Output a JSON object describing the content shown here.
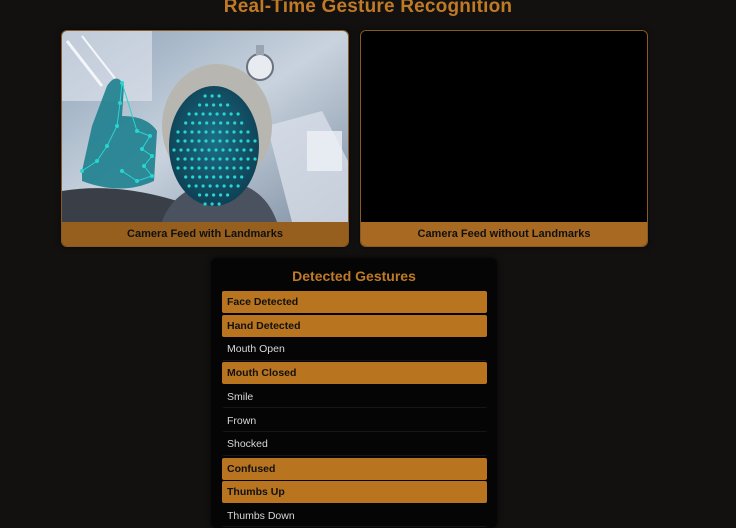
{
  "page": {
    "title": "Real-Time Gesture Recognition"
  },
  "feeds": {
    "with_landmarks": "Camera Feed with Landmarks",
    "without_landmarks": "Camera Feed without Landmarks"
  },
  "colors": {
    "accent": "#c07a26",
    "active_bg": "#b8741f",
    "background": "#121110",
    "landmark": "#27d6d0"
  },
  "gestures": {
    "title": "Detected Gestures",
    "items": [
      {
        "label": "Face Detected",
        "active": true
      },
      {
        "label": "Hand Detected",
        "active": true
      },
      {
        "label": "Mouth Open",
        "active": false
      },
      {
        "label": "Mouth Closed",
        "active": true
      },
      {
        "label": "Smile",
        "active": false
      },
      {
        "label": "Frown",
        "active": false
      },
      {
        "label": "Shocked",
        "active": false
      },
      {
        "label": "Confused",
        "active": true
      },
      {
        "label": "Thumbs Up",
        "active": true
      },
      {
        "label": "Thumbs Down",
        "active": false
      }
    ]
  }
}
